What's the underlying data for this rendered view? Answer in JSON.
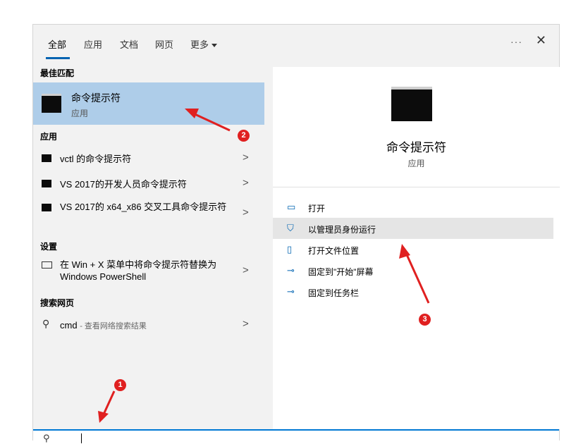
{
  "tabs": [
    {
      "label": "全部"
    },
    {
      "label": "应用"
    },
    {
      "label": "文档"
    },
    {
      "label": "网页"
    },
    {
      "label": "更多"
    }
  ],
  "header": {
    "more_dots": "···",
    "close_symbol": "✕"
  },
  "best_match": {
    "header": "最佳匹配",
    "title": "命令提示符",
    "subtitle": "应用"
  },
  "apps": {
    "header": "应用",
    "items": [
      {
        "label": "vctl 的命令提示符"
      },
      {
        "label": "VS 2017的开发人员命令提示符"
      },
      {
        "label": "VS 2017的 x64_x86 交叉工具命令提示符"
      }
    ]
  },
  "settings": {
    "header": "设置",
    "items": [
      {
        "label": "在 Win + X 菜单中将命令提示符替换为 Windows PowerShell"
      }
    ]
  },
  "web": {
    "header": "搜索网页",
    "query": "cmd",
    "suffix": "- 查看网络搜索结果"
  },
  "detail": {
    "title": "命令提示符",
    "subtitle": "应用",
    "actions": [
      {
        "label": "打开",
        "icon": "open-icon"
      },
      {
        "label": "以管理员身份运行",
        "icon": "shield-icon"
      },
      {
        "label": "打开文件位置",
        "icon": "folder-icon"
      },
      {
        "label": "固定到\"开始\"屏幕",
        "icon": "pin-icon"
      },
      {
        "label": "固定到任务栏",
        "icon": "pin-icon"
      }
    ]
  },
  "annotations": [
    "1",
    "2",
    "3"
  ],
  "colors": {
    "accent": "#0063b1",
    "selected": "#aecde9",
    "annotation": "#e02020"
  }
}
